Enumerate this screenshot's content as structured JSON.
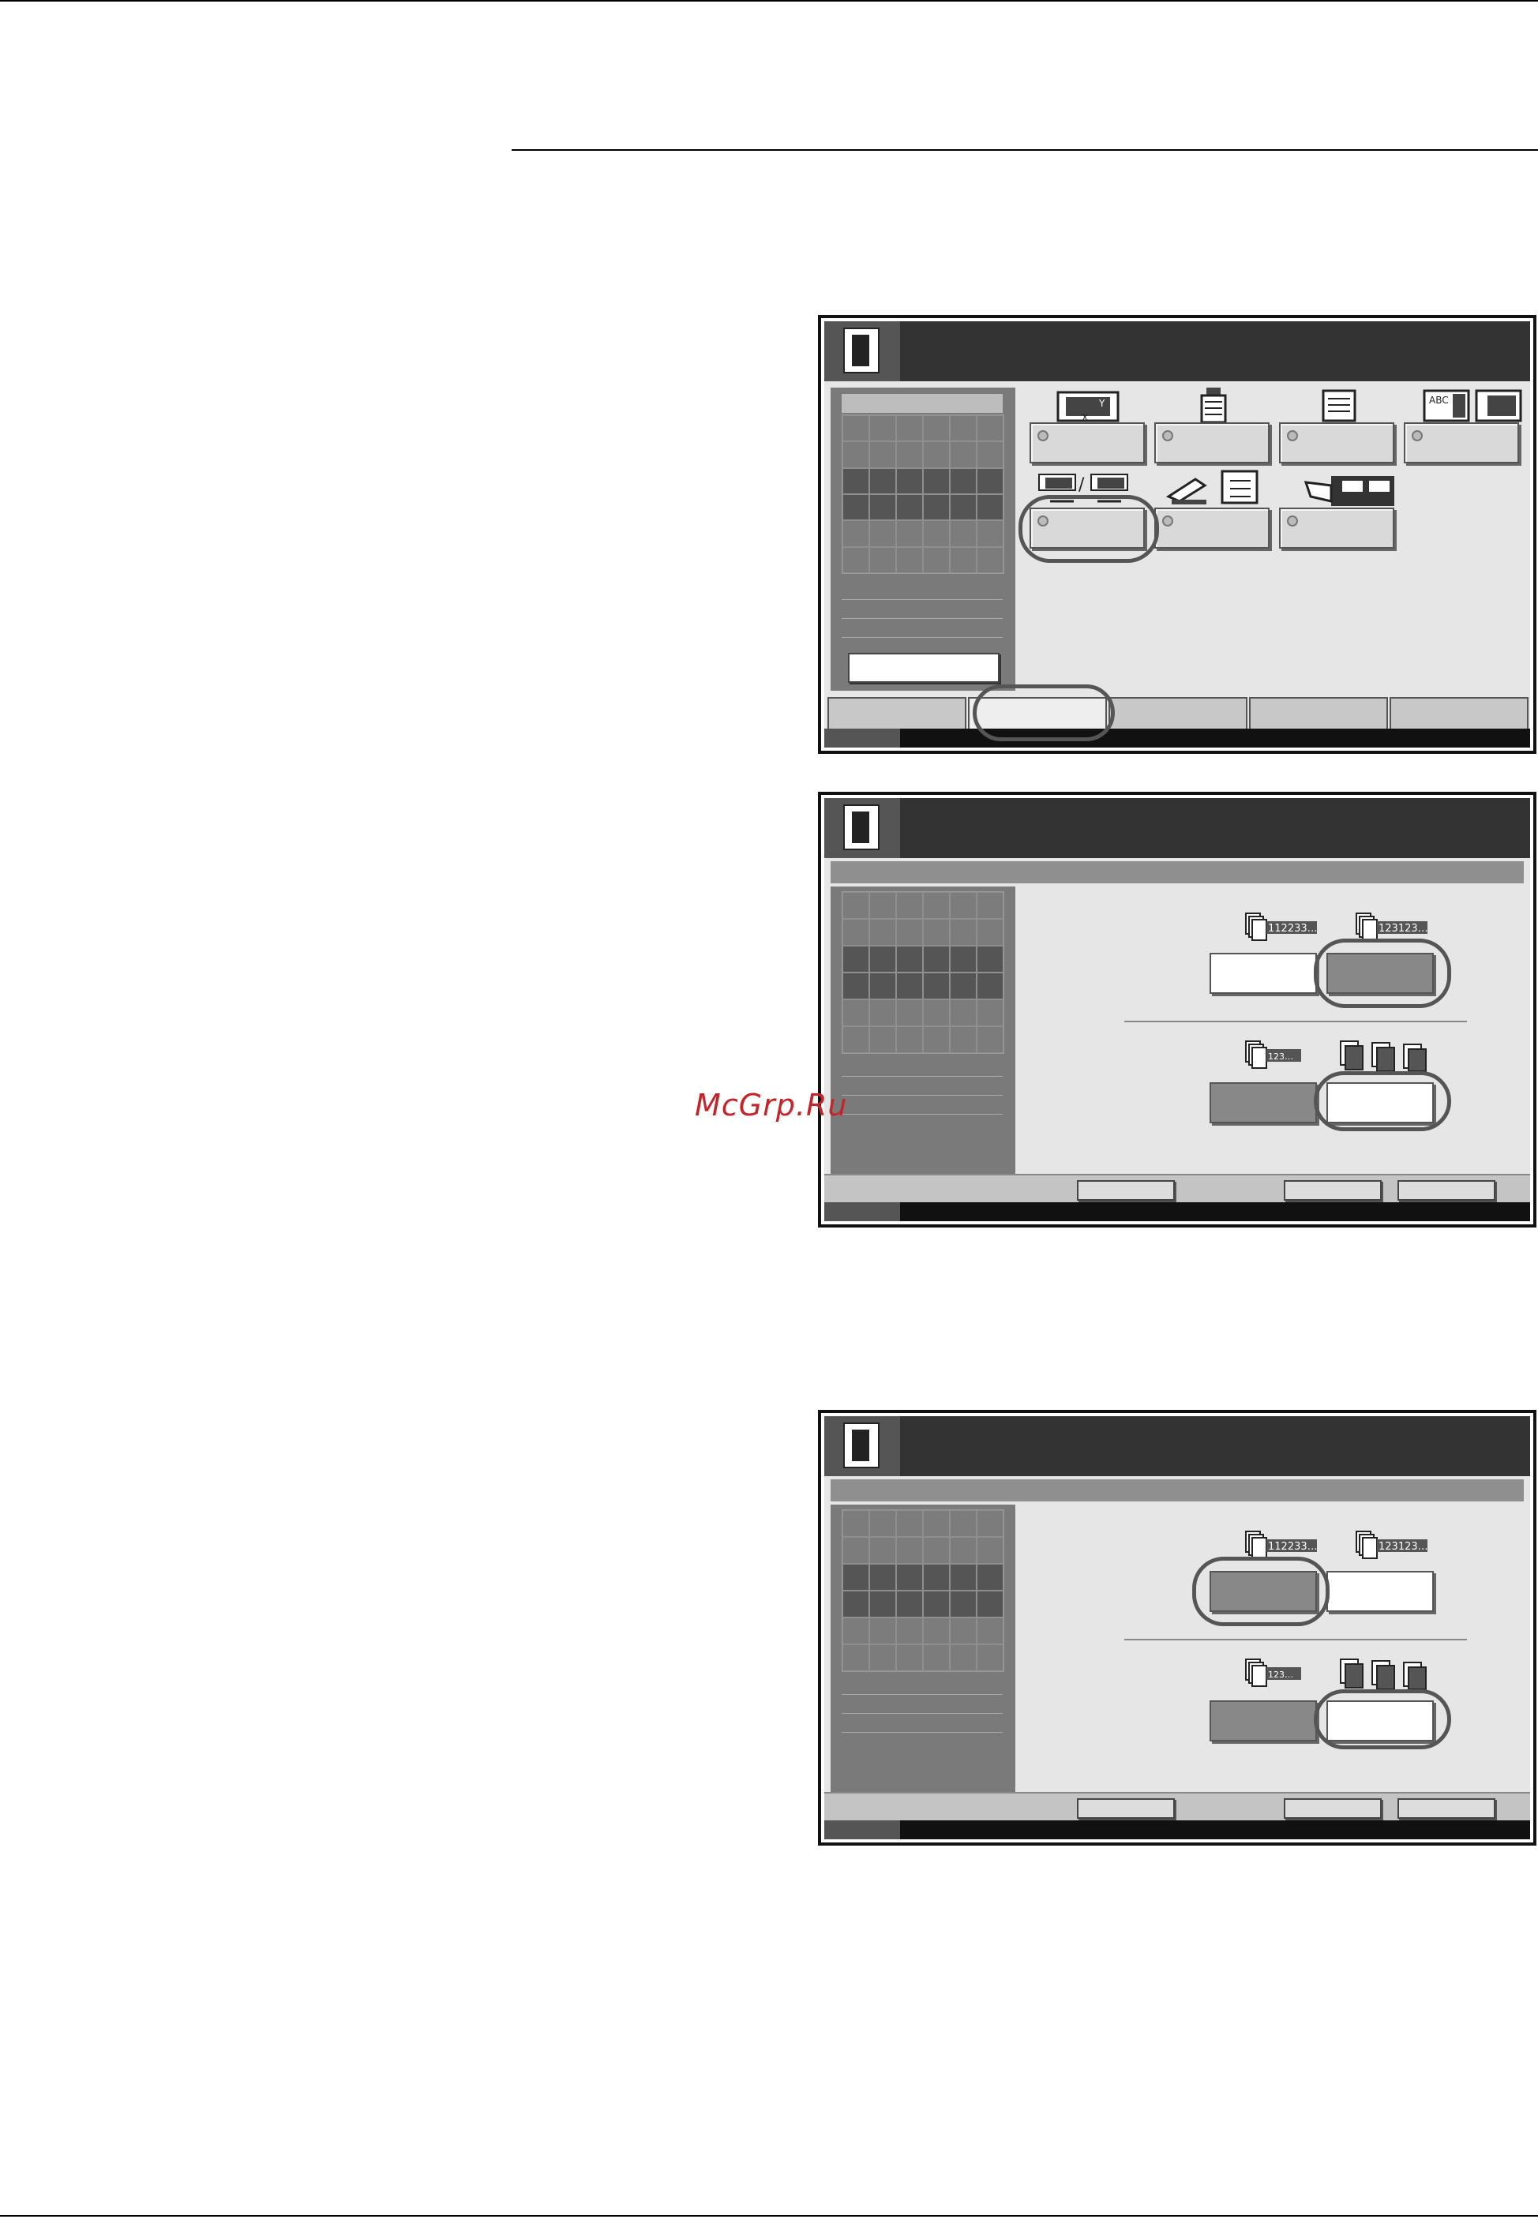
{
  "watermark": {
    "text": "McGrp.Ru"
  },
  "screens": [
    {
      "id": "function-menu"
    },
    {
      "id": "collate-offset-1"
    },
    {
      "id": "collate-offset-2"
    }
  ],
  "colors": {
    "titlebar": "#333333",
    "panel": "#7a7a7a",
    "highlight": "#555555",
    "watermark": "#c2262b"
  }
}
